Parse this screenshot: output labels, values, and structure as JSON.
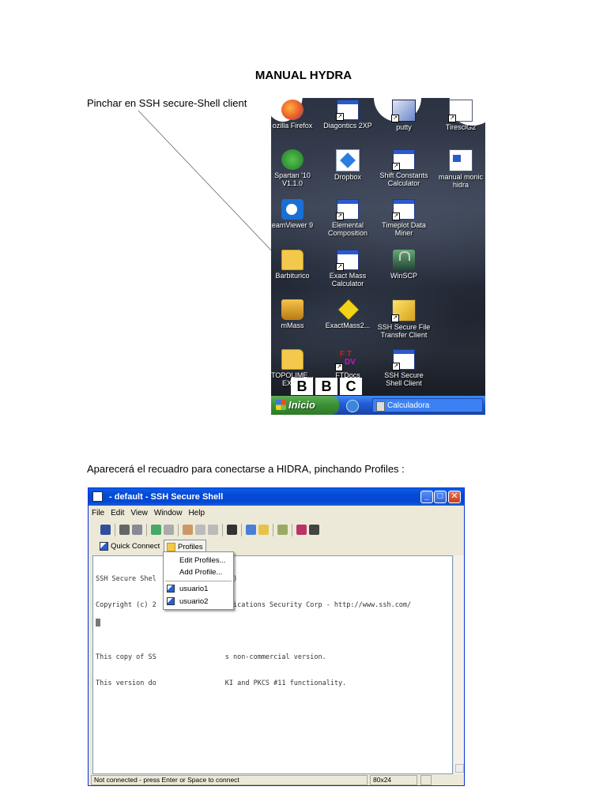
{
  "document": {
    "title": "MANUAL HYDRA",
    "step1": "Pinchar en SSH secure-Shell client",
    "step2": "Aparecerá el recuadro para conectarse a HIDRA, pinchando Profiles :"
  },
  "desktop": {
    "icons": [
      {
        "label": "ozilla Firefox",
        "icon": "firefox-icon"
      },
      {
        "label": "Diagontics 2XP",
        "icon": "shortcut-icon"
      },
      {
        "label": "putty",
        "icon": "putty-icon"
      },
      {
        "label": "TiresclG2",
        "icon": "shortcut-icon"
      },
      {
        "label": "Spartan '10 V1.1.0",
        "icon": "spartan-icon"
      },
      {
        "label": "Dropbox",
        "icon": "dropbox-icon"
      },
      {
        "label": "Shift Constants Calculator",
        "icon": "window-icon"
      },
      {
        "label": "manual monic hidra",
        "icon": "document-icon"
      },
      {
        "label": "eamViewer 9",
        "icon": "teamviewer-icon"
      },
      {
        "label": "Elemental Composition",
        "icon": "window-icon"
      },
      {
        "label": "Timeplot Data Miner",
        "icon": "window-icon"
      },
      {
        "label": "Barbiturico",
        "icon": "folder-icon"
      },
      {
        "label": "Exact Mass Calculator",
        "icon": "window-icon"
      },
      {
        "label": "WinSCP",
        "icon": "winscp-icon"
      },
      {
        "label": "mMass",
        "icon": "mmass-icon"
      },
      {
        "label": "ExactMass2...",
        "icon": "exactmass-icon"
      },
      {
        "label": "SSH Secure File Transfer Client",
        "icon": "ssh-file-transfer-icon"
      },
      {
        "label": "TOPOLIME... EXIFS",
        "icon": "folder-icon"
      },
      {
        "label": "FTDocs",
        "icon": "ftdocs-icon"
      },
      {
        "label": "SSH Secure Shell Client",
        "icon": "ssh-client-icon"
      }
    ],
    "bbc": [
      "B",
      "B",
      "C"
    ],
    "taskbar": {
      "start_label": "Inicio",
      "task_label": "Calculadora"
    }
  },
  "ssh_window": {
    "title": "- default - SSH Secure Shell",
    "menu": [
      "File",
      "Edit",
      "View",
      "Window",
      "Help"
    ],
    "quick_connect_label": "Quick Connect",
    "profiles_label": "Profiles",
    "dropdown": {
      "edit_profiles": "Edit Profiles...",
      "add_profile": "Add Profile...",
      "profile_items": [
        "usuario1",
        "usuario2"
      ]
    },
    "terminal_lines": [
      "SSH Secure Shel                  3)",
      "Copyright (c) 2                 unications Security Corp - http://www.ssh.com/",
      "",
      "This copy of SS                 s non-commercial version.",
      "This version do                 KI and PKCS #11 functionality."
    ],
    "status_text": "Not connected - press Enter or Space to connect",
    "status_size": "80x24"
  },
  "colors": {
    "xp_title_blue": "#0548d0",
    "xp_window_face": "#ece9d8",
    "taskbar_blue": "#245edc",
    "start_green": "#3a8f33"
  }
}
